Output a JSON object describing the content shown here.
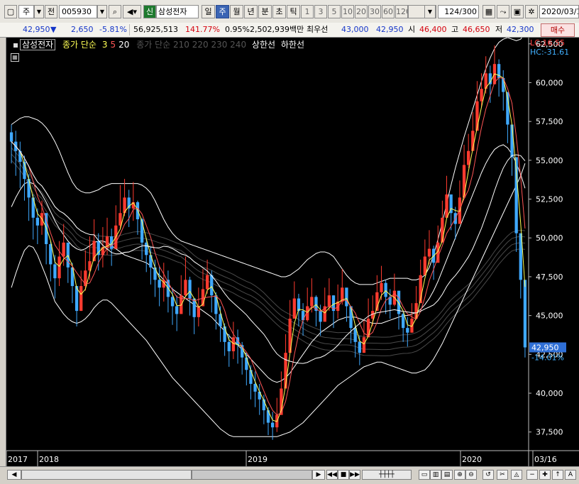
{
  "toolbar": {
    "market_label": "주",
    "market_dropdown": "▼",
    "prev_label": "전",
    "stock_code": "005930",
    "stock_name_badge": "신",
    "stock_name": "삼성전자",
    "periods": [
      "일",
      "주",
      "월",
      "년",
      "분",
      "초",
      "틱"
    ],
    "active_period": "주",
    "intervals": [
      "1",
      "3",
      "5",
      "10",
      "20",
      "30",
      "60",
      "120"
    ],
    "count_value": "124",
    "count_total": "/300",
    "date_value": "2020/03/1"
  },
  "quote": {
    "price": "42,950",
    "direction": "▼",
    "change": "2,650",
    "change_pct": "-5.81%",
    "volume": "56,925,513",
    "volume_pct": "141.77%",
    "turnover_pct": "0.95%",
    "amount": "2,502,939백만",
    "best_ask_label": "최우선",
    "best_ask": "43,000",
    "best_bid": "42,950",
    "open_label": "시",
    "open": "46,400",
    "high_label": "고",
    "high": "46,650",
    "low_label": "저",
    "low": "42,300",
    "buy_button": "매수"
  },
  "legend": {
    "stock_name": "삼성전자",
    "ma_label": "종가 단순",
    "ma_periods": [
      "3",
      "5",
      "20"
    ],
    "ma_colors": [
      "#ffff55",
      "#ff5555",
      "#ffffff"
    ],
    "ma_long_label": "종가 단순",
    "ma_long_periods": "210 220 230 240",
    "upper_limit_label": "상한선",
    "lower_limit_label": "하한선"
  },
  "chart_data": {
    "type": "candlestick",
    "y_ticks": [
      37500,
      40000,
      42500,
      45000,
      47500,
      50000,
      52500,
      55000,
      57500,
      60000,
      62500
    ],
    "ylim": [
      36300,
      62900
    ],
    "x_labels": [
      "2017",
      "2018",
      "2019",
      "2020",
      "03/16"
    ],
    "right_labels": {
      "lc": "LC:16.55",
      "hc": "HC:-31.61",
      "current_price": "42,950",
      "current_pct": "-14.01%"
    },
    "colors": {
      "up": "#ff3b2f",
      "down": "#3fa9ff",
      "ma3": "#ffff55",
      "ma5": "#ff5555",
      "ma20": "#ffffff",
      "bands": "#ffffff",
      "long_ma": "#4a4a4a"
    },
    "closes": [
      56200,
      55600,
      54900,
      53800,
      52600,
      51300,
      50800,
      51600,
      49600,
      48300,
      47400,
      48800,
      49700,
      48100,
      46900,
      45300,
      46900,
      47900,
      48500,
      49800,
      48900,
      49400,
      50100,
      49300,
      50800,
      51600,
      52600,
      51900,
      52300,
      51200,
      49700,
      48900,
      48100,
      47300,
      46800,
      47300,
      46200,
      45600,
      45100,
      46300,
      47300,
      46100,
      44900,
      45600,
      46700,
      47600,
      46300,
      45100,
      44300,
      43300,
      42700,
      43600,
      43100,
      42300,
      41500,
      40600,
      40100,
      39600,
      38900,
      38100,
      37800,
      38600,
      40300,
      42600,
      44800,
      46100,
      45300,
      44700,
      45600,
      46200,
      45300,
      44600,
      45600,
      46300,
      45300,
      45900,
      46800,
      45600,
      44200,
      43300,
      42600,
      43600,
      44800,
      45300,
      46500,
      47100,
      46200,
      45700,
      46600,
      45100,
      44200,
      43900,
      44800,
      45800,
      47600,
      48800,
      49300,
      48400,
      49700,
      51300,
      52800,
      51600,
      50900,
      52600,
      54700,
      55600,
      56900,
      58800,
      59600,
      60600,
      59900,
      61200,
      60300,
      59400,
      57300,
      55200,
      50300,
      47300,
      42950
    ],
    "ranges": [
      [
        54800,
        57300
      ],
      [
        54000,
        56900
      ],
      [
        53200,
        56200
      ],
      [
        52400,
        55300
      ],
      [
        51100,
        54100
      ],
      [
        49900,
        52800
      ],
      [
        49600,
        51900
      ],
      [
        50200,
        52400
      ],
      [
        48300,
        51400
      ],
      [
        47200,
        49800
      ],
      [
        46100,
        48900
      ],
      [
        46900,
        49800
      ],
      [
        48200,
        50900
      ],
      [
        47100,
        49500
      ],
      [
        45800,
        48400
      ],
      [
        44300,
        46900
      ],
      [
        45300,
        47900
      ],
      [
        46600,
        49200
      ],
      [
        47300,
        50100
      ],
      [
        48500,
        51200
      ],
      [
        47900,
        50300
      ],
      [
        48100,
        50700
      ],
      [
        48900,
        51300
      ],
      [
        48200,
        50600
      ],
      [
        49500,
        52100
      ],
      [
        50600,
        53400
      ],
      [
        51400,
        53800
      ],
      [
        50700,
        53100
      ],
      [
        51100,
        53600
      ],
      [
        50200,
        52400
      ],
      [
        48600,
        51300
      ],
      [
        47800,
        50000
      ],
      [
        47000,
        49400
      ],
      [
        46200,
        48600
      ],
      [
        45600,
        48200
      ],
      [
        45900,
        48400
      ],
      [
        45200,
        47900
      ],
      [
        44400,
        46800
      ],
      [
        44000,
        46300
      ],
      [
        45100,
        47600
      ],
      [
        46200,
        48800
      ],
      [
        45000,
        47500
      ],
      [
        43800,
        46100
      ],
      [
        44300,
        46800
      ],
      [
        45600,
        48000
      ],
      [
        46400,
        48600
      ],
      [
        45200,
        47900
      ],
      [
        44100,
        46500
      ],
      [
        43300,
        45600
      ],
      [
        42400,
        44500
      ],
      [
        41700,
        43800
      ],
      [
        42200,
        44600
      ],
      [
        41900,
        44100
      ],
      [
        41200,
        43300
      ],
      [
        40500,
        42600
      ],
      [
        39600,
        41800
      ],
      [
        39100,
        41400
      ],
      [
        38600,
        40600
      ],
      [
        38000,
        39900
      ],
      [
        37300,
        39100
      ],
      [
        37000,
        38800
      ],
      [
        37500,
        39700
      ],
      [
        39200,
        41400
      ],
      [
        41600,
        43800
      ],
      [
        43700,
        46000
      ],
      [
        45100,
        47200
      ],
      [
        44300,
        46400
      ],
      [
        43700,
        45800
      ],
      [
        44600,
        46800
      ],
      [
        45200,
        47400
      ],
      [
        44300,
        46300
      ],
      [
        43700,
        45700
      ],
      [
        44700,
        46800
      ],
      [
        45300,
        47400
      ],
      [
        44200,
        46300
      ],
      [
        44800,
        47000
      ],
      [
        45700,
        48000
      ],
      [
        44600,
        46600
      ],
      [
        43200,
        45300
      ],
      [
        42300,
        44400
      ],
      [
        41800,
        43700
      ],
      [
        42700,
        44700
      ],
      [
        43800,
        46100
      ],
      [
        44300,
        46300
      ],
      [
        45400,
        47600
      ],
      [
        46000,
        48200
      ],
      [
        45100,
        47300
      ],
      [
        44800,
        46700
      ],
      [
        45600,
        47700
      ],
      [
        44100,
        46200
      ],
      [
        43300,
        45200
      ],
      [
        43000,
        44900
      ],
      [
        43900,
        45800
      ],
      [
        44900,
        46900
      ],
      [
        46500,
        48600
      ],
      [
        47700,
        49900
      ],
      [
        48300,
        50500
      ],
      [
        47300,
        49500
      ],
      [
        48800,
        50800
      ],
      [
        50200,
        52400
      ],
      [
        51600,
        54000
      ],
      [
        50500,
        52700
      ],
      [
        49900,
        52000
      ],
      [
        51500,
        53700
      ],
      [
        53600,
        56000
      ],
      [
        54500,
        56700
      ],
      [
        55700,
        58100
      ],
      [
        57600,
        60100
      ],
      [
        58400,
        60600
      ],
      [
        59300,
        61700
      ],
      [
        58700,
        61100
      ],
      [
        59900,
        62400
      ],
      [
        59100,
        61500
      ],
      [
        58200,
        60800
      ],
      [
        56100,
        58500
      ],
      [
        54000,
        56400
      ],
      [
        49100,
        51600
      ],
      [
        46100,
        48400
      ],
      [
        42300,
        46650
      ]
    ],
    "upper_band": [
      57300,
      57500,
      57700,
      57800,
      57800,
      57700,
      57600,
      57400,
      57100,
      56700,
      56200,
      55600,
      54900,
      54200,
      53600,
      53200,
      53000,
      52900,
      52900,
      53000,
      53100,
      53300,
      53400,
      53500,
      53500,
      53500,
      53500,
      53500,
      53500,
      53500,
      53400,
      53200,
      52900,
      52400,
      51800,
      51200,
      50700,
      50300,
      50000,
      49800,
      49700,
      49600,
      49500,
      49400,
      49300,
      49200,
      49100,
      49000,
      48900,
      48800,
      48700,
      48600,
      48500,
      48400,
      48300,
      48200,
      48100,
      48000,
      47900,
      47800,
      47700,
      47600,
      47500,
      47500,
      47600,
      47800,
      48000,
      48300,
      48600,
      48800,
      49000,
      49100,
      49100,
      49000,
      48800,
      48400,
      48000,
      47600,
      47300,
      47100,
      47000,
      47000,
      47000,
      47000,
      47100,
      47200,
      47300,
      47400,
      47400,
      47400,
      47400,
      47400,
      47300,
      47300,
      47400,
      47600,
      48100,
      48900,
      49900,
      51000,
      52200,
      53400,
      54500,
      55500,
      56500,
      57400,
      58300,
      59200,
      60100,
      60900,
      61600,
      62200,
      62600,
      62800,
      62900,
      62800,
      62700,
      62800,
      63200
    ],
    "middle_band": [
      52000,
      52600,
      53100,
      53500,
      53600,
      53500,
      53200,
      52800,
      52300,
      51700,
      51100,
      50600,
      50200,
      49800,
      49500,
      49300,
      49200,
      49300,
      49500,
      49700,
      49800,
      49800,
      49700,
      49500,
      49300,
      49100,
      48900,
      48800,
      48700,
      48600,
      48500,
      48400,
      48200,
      47900,
      47600,
      47300,
      47000,
      46700,
      46500,
      46300,
      46100,
      45900,
      45700,
      45500,
      45300,
      45100,
      44900,
      44600,
      44300,
      44000,
      43700,
      43400,
      43100,
      42800,
      42500,
      42200,
      41900,
      41600,
      41300,
      41000,
      40800,
      40700,
      40800,
      41000,
      41300,
      41700,
      42100,
      42500,
      42900,
      43300,
      43600,
      43900,
      44100,
      44300,
      44500,
      44700,
      44800,
      44900,
      44900,
      44900,
      44800,
      44700,
      44600,
      44500,
      44500,
      44500,
      44600,
      44700,
      44800,
      44900,
      45000,
      45000,
      45100,
      45200,
      45400,
      45700,
      46100,
      46600,
      47200,
      47900,
      48600,
      49300,
      50000,
      50700,
      51400,
      52100,
      52800,
      53500,
      54200,
      54800,
      55300,
      55700,
      55900,
      56000,
      55800,
      55400,
      54800,
      54100,
      53200
    ],
    "lower_band": [
      46800,
      47700,
      48500,
      49200,
      49500,
      49400,
      48900,
      48200,
      47500,
      46700,
      45900,
      45500,
      45100,
      44800,
      44600,
      44500,
      44600,
      44800,
      45100,
      45500,
      45800,
      46000,
      46000,
      45800,
      45500,
      45200,
      44900,
      44600,
      44300,
      44000,
      43700,
      43400,
      43000,
      42600,
      42200,
      41800,
      41400,
      41000,
      40700,
      40400,
      40100,
      39800,
      39500,
      39200,
      38900,
      38600,
      38300,
      38000,
      37700,
      37500,
      37300,
      37200,
      37200,
      37200,
      37200,
      37200,
      37200,
      37200,
      37200,
      37200,
      37200,
      37200,
      37300,
      37400,
      37500,
      37700,
      37900,
      38100,
      38400,
      38700,
      39000,
      39300,
      39600,
      39900,
      40200,
      40500,
      40700,
      40900,
      41100,
      41300,
      41500,
      41700,
      41800,
      41900,
      42000,
      42000,
      41900,
      41800,
      41700,
      41600,
      41500,
      41400,
      41300,
      41300,
      41400,
      41500,
      41800,
      42200,
      42700,
      43200,
      43800,
      44400,
      45000,
      45600,
      46200,
      46800,
      47400,
      48000,
      48600,
      49200,
      49800,
      50400,
      51000,
      51600,
      52200,
      52800,
      53400,
      54000,
      54800
    ]
  }
}
